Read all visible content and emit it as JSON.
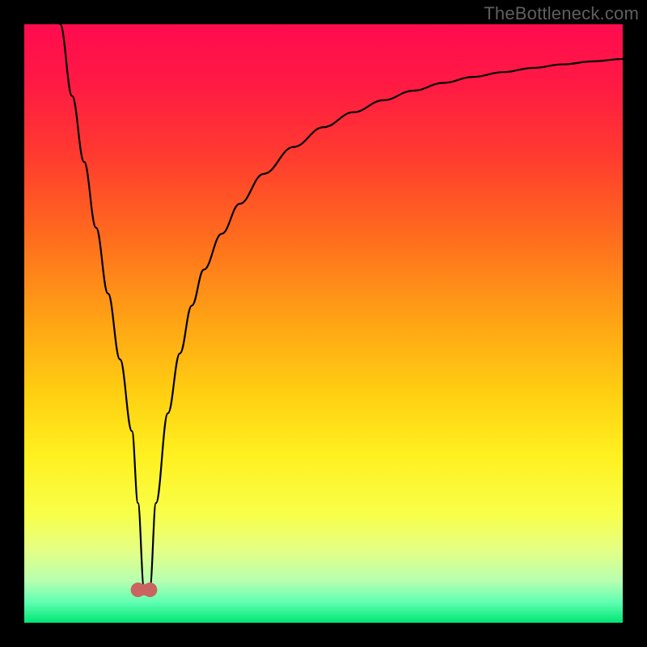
{
  "watermark": "TheBottleneck.com",
  "gradient": {
    "stops": [
      {
        "offset": 0.0,
        "color": "#ff0b4f"
      },
      {
        "offset": 0.1,
        "color": "#ff1a43"
      },
      {
        "offset": 0.22,
        "color": "#ff3b2f"
      },
      {
        "offset": 0.35,
        "color": "#ff6a1e"
      },
      {
        "offset": 0.5,
        "color": "#ffa514"
      },
      {
        "offset": 0.62,
        "color": "#ffd012"
      },
      {
        "offset": 0.72,
        "color": "#fff020"
      },
      {
        "offset": 0.82,
        "color": "#f8ff4a"
      },
      {
        "offset": 0.88,
        "color": "#e4ff86"
      },
      {
        "offset": 0.93,
        "color": "#b7ffb0"
      },
      {
        "offset": 0.965,
        "color": "#62ffb3"
      },
      {
        "offset": 1.0,
        "color": "#00e673"
      }
    ]
  },
  "chart_data": {
    "type": "line",
    "title": "",
    "xlabel": "",
    "ylabel": "",
    "xlim": [
      0,
      100
    ],
    "ylim": [
      0,
      100
    ],
    "grid": false,
    "legend": false,
    "series": [
      {
        "name": "bottleneck-curve",
        "x": [
          6,
          8,
          10,
          12,
          14,
          16,
          18,
          19,
          20,
          21,
          22,
          24,
          26,
          28,
          30,
          33,
          36,
          40,
          45,
          50,
          55,
          60,
          65,
          70,
          75,
          80,
          85,
          90,
          95,
          100
        ],
        "y": [
          100,
          88,
          77,
          66,
          55,
          44,
          32,
          20,
          6,
          6,
          20,
          35,
          45,
          53,
          59,
          65,
          70,
          75,
          79.5,
          82.8,
          85.3,
          87.3,
          88.9,
          90.2,
          91.2,
          92.0,
          92.7,
          93.3,
          93.8,
          94.2
        ]
      }
    ],
    "markers": [
      {
        "name": "min-left",
        "x": 19.0,
        "y": 5.5
      },
      {
        "name": "min-right",
        "x": 21.0,
        "y": 5.5
      }
    ],
    "marker_color": "#c96460",
    "curve_color": "#000000"
  }
}
